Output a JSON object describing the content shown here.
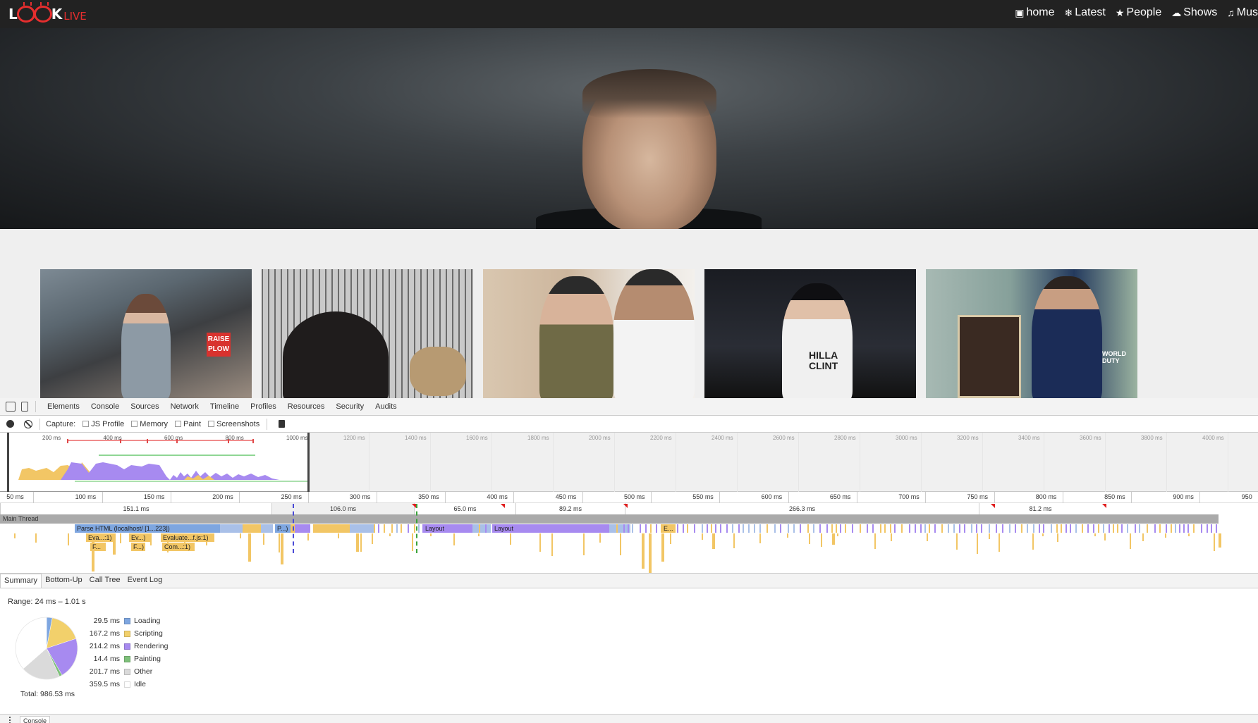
{
  "site": {
    "logo_text": "LOOK",
    "logo_suffix": "LIVE",
    "nav": [
      {
        "icon": "camera-icon",
        "glyph": "▣",
        "label": "home"
      },
      {
        "icon": "snowflake-icon",
        "glyph": "❄",
        "label": "Latest"
      },
      {
        "icon": "star-icon",
        "glyph": "★",
        "label": "People"
      },
      {
        "icon": "cloud-icon",
        "glyph": "☁",
        "label": "Shows"
      },
      {
        "icon": "music-icon",
        "glyph": "♫",
        "label": "Mus"
      }
    ],
    "hero_alt": "hero-portrait",
    "thumbnails": [
      {
        "name": "thumbnail-woman-phone",
        "sign": "RAISE PLOW"
      },
      {
        "name": "thumbnail-woman-cage",
        "sign": ""
      },
      {
        "name": "thumbnail-two-men",
        "sign": ""
      },
      {
        "name": "thumbnail-woman-night",
        "sign": "HILLA CLINT"
      },
      {
        "name": "thumbnail-man-suit",
        "sign": "WORLD DUTY"
      }
    ]
  },
  "devtools": {
    "tabs": [
      "Elements",
      "Console",
      "Sources",
      "Network",
      "Timeline",
      "Profiles",
      "Resources",
      "Security",
      "Audits"
    ],
    "capture_label": "Capture:",
    "checkboxes": [
      "JS Profile",
      "Memory",
      "Paint",
      "Screenshots"
    ],
    "overview_labels": [
      "200 ms",
      "400 ms",
      "600 ms",
      "800 ms",
      "1000 ms",
      "1200 ms",
      "1400 ms",
      "1600 ms",
      "1800 ms",
      "2000 ms",
      "2200 ms",
      "2400 ms",
      "2600 ms",
      "2800 ms",
      "3000 ms",
      "3200 ms",
      "3400 ms",
      "3600 ms",
      "3800 ms",
      "4000 ms"
    ],
    "ruler_labels": [
      "50 ms",
      "100 ms",
      "150 ms",
      "200 ms",
      "250 ms",
      "300 ms",
      "350 ms",
      "400 ms",
      "450 ms",
      "500 ms",
      "550 ms",
      "600 ms",
      "650 ms",
      "700 ms",
      "750 ms",
      "800 ms",
      "850 ms",
      "900 ms",
      "950"
    ],
    "frame_durations": [
      "151.1 ms",
      "106.0 ms",
      "65.0 ms",
      "89.2 ms",
      "266.3 ms",
      "81.2 ms"
    ],
    "main_thread_label": "Main Thread",
    "flame_labels": {
      "parse_html": "Parse HTML (localhost/ [1...223])",
      "p": "P...)",
      "layout1": "Layout",
      "layout2": "Layout",
      "e": "E...",
      "eva1": "Eva...:1)",
      "ev2": "Ev...)",
      "evaluate": "Evaluate...f.js:1)",
      "f1": "F...",
      "f2": "F...)",
      "com": "Com...:1)"
    },
    "summary_tabs": [
      "Summary",
      "Bottom-Up",
      "Call Tree",
      "Event Log"
    ],
    "range": "Range: 24 ms – 1.01 s",
    "breakdown": [
      {
        "value": "29.5 ms",
        "label": "Loading",
        "color": "#7ea6e0",
        "ms": 29.5
      },
      {
        "value": "167.2 ms",
        "label": "Scripting",
        "color": "#f2d06b",
        "ms": 167.2
      },
      {
        "value": "214.2 ms",
        "label": "Rendering",
        "color": "#a78af0",
        "ms": 214.2
      },
      {
        "value": "14.4 ms",
        "label": "Painting",
        "color": "#7ec07a",
        "ms": 14.4
      },
      {
        "value": "201.7 ms",
        "label": "Other",
        "color": "#dadada",
        "ms": 201.7
      },
      {
        "value": "359.5 ms",
        "label": "Idle",
        "color": "#ffffff",
        "ms": 359.5
      }
    ],
    "total": "Total: 986.53 ms",
    "console_tab": "Console"
  }
}
